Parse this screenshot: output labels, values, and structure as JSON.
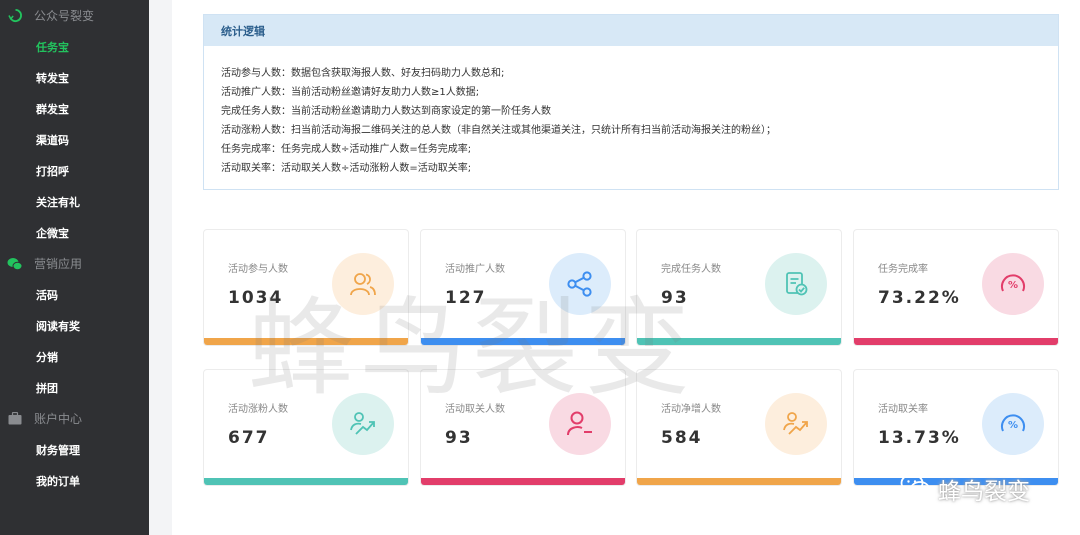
{
  "sidebar": {
    "sections": [
      {
        "title": "公众号裂变",
        "icon": "recycle-icon",
        "items": [
          "任务宝",
          "转发宝",
          "群发宝",
          "渠道码",
          "打招呼",
          "关注有礼",
          "企微宝"
        ]
      },
      {
        "title": "营销应用",
        "icon": "wechat-icon",
        "items": [
          "活码",
          "阅读有奖",
          "分销",
          "拼团"
        ]
      },
      {
        "title": "账户中心",
        "icon": "briefcase-icon",
        "items": [
          "财务管理",
          "我的订单"
        ]
      }
    ],
    "active_item": "任务宝",
    "active_color": "#22c35e"
  },
  "logic": {
    "title": "统计逻辑",
    "lines": [
      "活动参与人数：数据包含获取海报人数、好友扫码助力人数总和;",
      "活动推广人数：当前活动粉丝邀请好友助力人数≥1人数据;",
      "完成任务人数：当前活动粉丝邀请助力人数达到商家设定的第一阶任务人数",
      "活动涨粉人数：扫当前活动海报二维码关注的总人数（非自然关注或其他渠道关注，只统计所有扫当前活动海报关注的粉丝）；",
      "任务完成率：任务完成人数÷活动推广人数=任务完成率;",
      "活动取关率：活动取关人数÷活动涨粉人数=活动取关率;"
    ]
  },
  "stats": [
    {
      "label": "活动参与人数",
      "value": "1034",
      "icon": "users-icon",
      "color": "#f0a54a",
      "bg": "#fdeedd"
    },
    {
      "label": "活动推广人数",
      "value": "127",
      "icon": "share-icon",
      "color": "#3d8ef0",
      "bg": "#dcecfb"
    },
    {
      "label": "完成任务人数",
      "value": "93",
      "icon": "task-check-icon",
      "color": "#4fc3b5",
      "bg": "#dcf2ef"
    },
    {
      "label": "任务完成率",
      "value": "73.22%",
      "icon": "gauge-percent-icon",
      "color": "#e23d6a",
      "bg": "#f9dae3"
    },
    {
      "label": "活动涨粉人数",
      "value": "677",
      "icon": "trend-up-icon",
      "color": "#4fc3b5",
      "bg": "#dcf2ef"
    },
    {
      "label": "活动取关人数",
      "value": "93",
      "icon": "user-minus-icon",
      "color": "#e23d6a",
      "bg": "#f9dae3"
    },
    {
      "label": "活动净增人数",
      "value": "584",
      "icon": "trend-up-icon",
      "color": "#f0a54a",
      "bg": "#fdeedd"
    },
    {
      "label": "活动取关率",
      "value": "13.73%",
      "icon": "gauge-percent-icon",
      "color": "#3d8ef0",
      "bg": "#dcecfb"
    }
  ],
  "watermark": "蜂鸟裂变",
  "brand": "蜂鸟裂变"
}
